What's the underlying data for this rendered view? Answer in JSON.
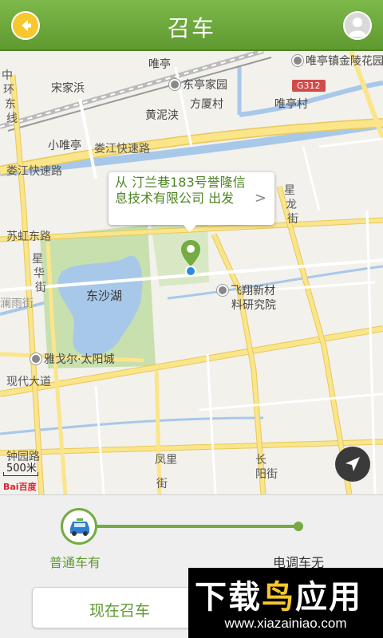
{
  "header": {
    "title": "召车",
    "back_icon": "back-arrow-icon",
    "user_icon": "user-avatar-icon"
  },
  "map": {
    "bubble_text": "从 汀兰巷183号誉隆信息技术有限公司 出发",
    "bubble_chevron": ">",
    "scale_text": "500米",
    "baidu_logo": "Bai百度",
    "road_badge": "G312",
    "labels": {
      "l1": "唯亭",
      "l2": "宋家浜",
      "l3": "东亭家园",
      "l4": "唯亭镇金陵花园",
      "l5": "方厦村",
      "l6": "黄泥浃",
      "l7": "唯亭村",
      "l8": "小唯亭",
      "l9": "娄江快速路",
      "l10": "娄江快速路",
      "l11": "苏虹东路",
      "l12": "东沙湖",
      "l13": "飞翔新材",
      "l14": "料研究院",
      "l15": "雅戈尔·太阳城",
      "l16": "现代大道",
      "l17": "钟园路",
      "l18": "凤里",
      "l19": "街",
      "l20": "长",
      "l21": "阳街",
      "l22": "中",
      "l23": "环",
      "l24": "东",
      "l25": "线",
      "l26": "星",
      "l27": "龙",
      "l28": "街",
      "l29": "星",
      "l30": "华",
      "l31": "街",
      "l32": "澜雨街"
    }
  },
  "panel": {
    "option_left": "普通车有",
    "option_right": "电调车无",
    "call_button": "现在召车",
    "taxi_icon": "taxi-icon"
  },
  "watermark": {
    "main_a": "下载",
    "main_b": "鸟",
    "main_c": "应用",
    "url": "www.xiazainiao.com"
  },
  "colors": {
    "brand_green": "#74ab43",
    "header_green": "#6aa83a",
    "accent_yellow": "#f6c72e",
    "road_yellow": "#fbe58a",
    "water_blue": "#a8c8ea",
    "park_green": "#c8dfae"
  }
}
